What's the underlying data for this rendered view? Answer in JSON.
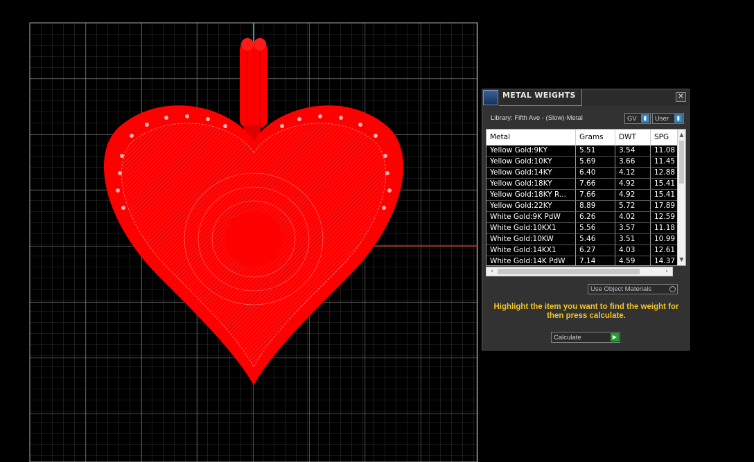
{
  "panel": {
    "title": "METAL WEIGHTS",
    "close_glyph": "✕",
    "library_label": "Library: Fifth Ave - (Slow)-Metal",
    "gv_combo": "GV",
    "user_combo": "User",
    "table": {
      "columns": [
        "Metal",
        "Grams",
        "DWT",
        "SPG"
      ],
      "rows": [
        [
          "Yellow Gold:9KY",
          "5.51",
          "3.54",
          "11.08"
        ],
        [
          "Yellow Gold:10KY",
          "5.69",
          "3.66",
          "11.45"
        ],
        [
          "Yellow Gold:14KY",
          "6.40",
          "4.12",
          "12.88"
        ],
        [
          "Yellow Gold:18KY",
          "7.66",
          "4.92",
          "15.41"
        ],
        [
          "Yellow Gold:18KY R...",
          "7.66",
          "4.92",
          "15.41"
        ],
        [
          "Yellow Gold:22KY",
          "8.89",
          "5.72",
          "17.89"
        ],
        [
          "White Gold:9K PdW",
          "6.26",
          "4.02",
          "12.59"
        ],
        [
          "White Gold:10KX1",
          "5.56",
          "3.57",
          "11.18"
        ],
        [
          "White Gold:10KW",
          "5.46",
          "3.51",
          "10.99"
        ],
        [
          "White Gold:14KX1",
          "6.27",
          "4.03",
          "12.61"
        ],
        [
          "White Gold:14K PdW",
          "7.14",
          "4.59",
          "14.37"
        ]
      ]
    },
    "use_object_materials": "Use Object Materials",
    "instructions": "Highlight the item you want to find the weight for then press calculate.",
    "calculate_label": "Calculate"
  },
  "icons": {
    "app": "app-logo-icon",
    "close": "close-icon",
    "dropdown": "dropdown-arrow-icon",
    "go": "play-icon"
  },
  "colors": {
    "heart": "#ff0000",
    "instructions": "#f2c422",
    "calc_button": "#1fa22b"
  }
}
